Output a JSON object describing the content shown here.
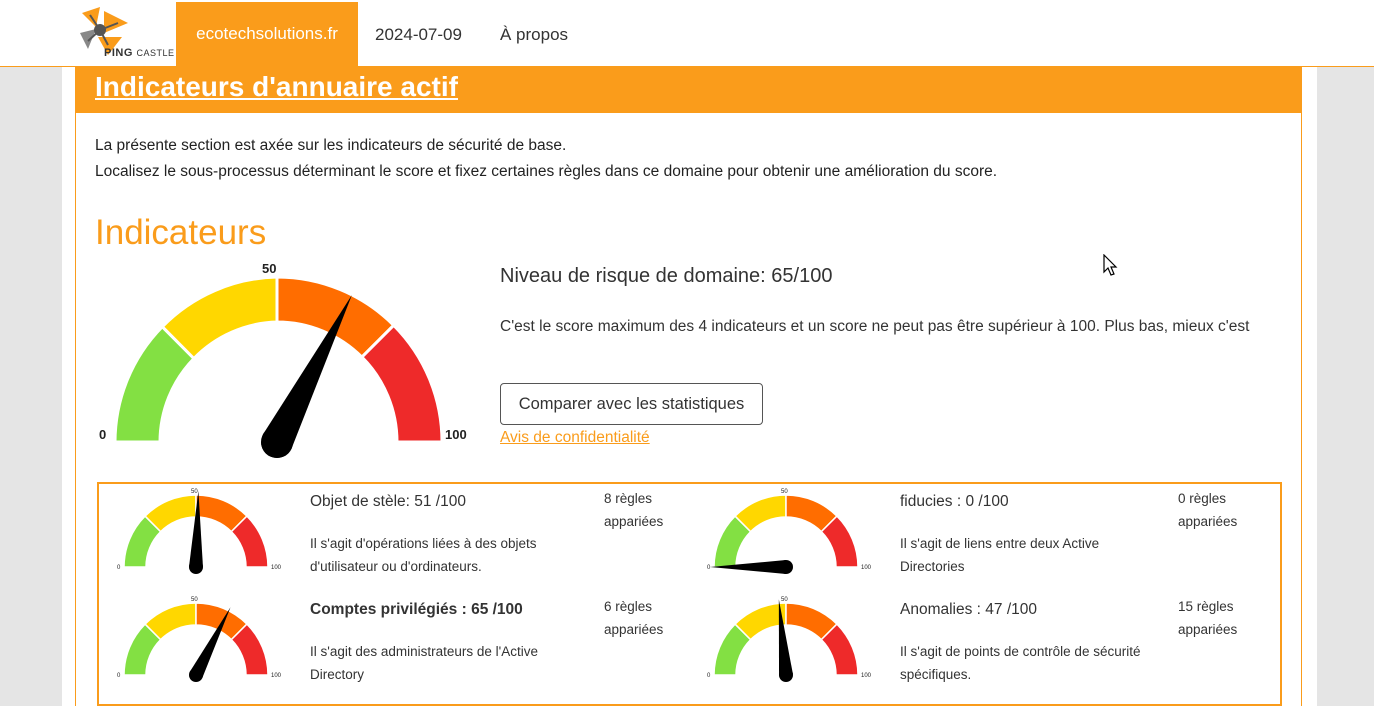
{
  "nav": {
    "logo_text": "PING",
    "logo_sub": "CASTLE",
    "domain": "ecotechsolutions.fr",
    "date": "2024-07-09",
    "about": "À propos"
  },
  "panel": {
    "title": "Indicateurs d'annuaire actif",
    "intro_line1": "La présente section est axée sur les indicateurs de sécurité de base.",
    "intro_line2": "Localisez le sous-processus déterminant le score et fixez certaines règles dans ce domaine pour obtenir une amélioration du score."
  },
  "section_title": "Indicateurs",
  "main_gauge": {
    "value": 65,
    "min_label": "0",
    "mid_label": "50",
    "max_label": "100"
  },
  "risk": {
    "title": "Niveau de risque de domaine: 65/100",
    "description": "C'est le score maximum des 4 indicateurs et un score ne peut pas être supérieur à 100. Plus bas, mieux c'est",
    "compare_button": "Comparer avec les statistiques",
    "privacy_link": "Avis de confidentialité"
  },
  "indicators": [
    {
      "title": "Objet de stèle: 51 /100",
      "value": 51,
      "desc_line1": "Il s'agit d'opérations liées à des objets",
      "desc_line2": "d'utilisateur ou d'ordinateurs.",
      "rules_line1": "8 règles",
      "rules_line2": "appariées",
      "bold": false
    },
    {
      "title": "fiducies : 0 /100",
      "value": 0,
      "desc_line1": "Il s'agit de liens entre deux Active",
      "desc_line2": "Directories",
      "rules_line1": "0 règles",
      "rules_line2": "appariées",
      "bold": false
    },
    {
      "title": "Comptes privilégiés : 65 /100",
      "value": 65,
      "desc_line1": "Il s'agit des administrateurs de l'Active",
      "desc_line2": "Directory",
      "rules_line1": "6 règles",
      "rules_line2": "appariées",
      "bold": true
    },
    {
      "title": "Anomalies : 47 /100",
      "value": 47,
      "desc_line1": "Il s'agit de points de contrôle de sécurité",
      "desc_line2": "spécifiques.",
      "rules_line1": "15 règles",
      "rules_line2": "appariées",
      "bold": false
    }
  ],
  "colors": {
    "accent": "#fa9c1b",
    "green": "#83e043",
    "yellow": "#ffd700",
    "orange": "#ff6d00",
    "red": "#ee2a2a"
  }
}
